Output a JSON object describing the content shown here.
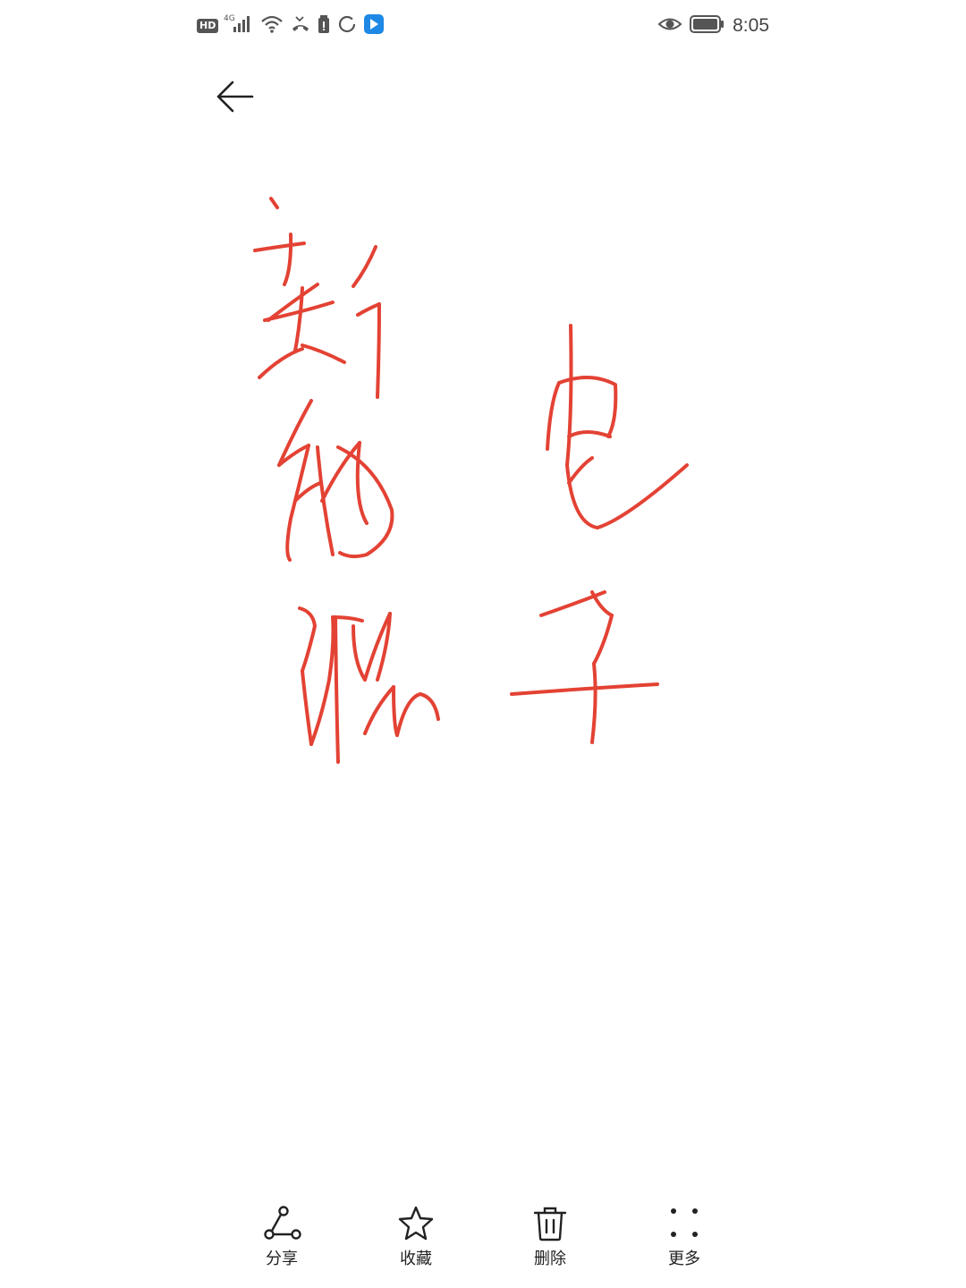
{
  "status_bar": {
    "left_badge": "HD",
    "network": "4G",
    "time": "8:05"
  },
  "image": {
    "handwriting_lines": [
      "新能源",
      "电车"
    ],
    "ink_color": "#e34234"
  },
  "toolbar": {
    "items": [
      {
        "label": "分享",
        "icon": "share-icon"
      },
      {
        "label": "收藏",
        "icon": "star-icon"
      },
      {
        "label": "删除",
        "icon": "trash-icon"
      },
      {
        "label": "更多",
        "icon": "more-icon"
      }
    ]
  }
}
